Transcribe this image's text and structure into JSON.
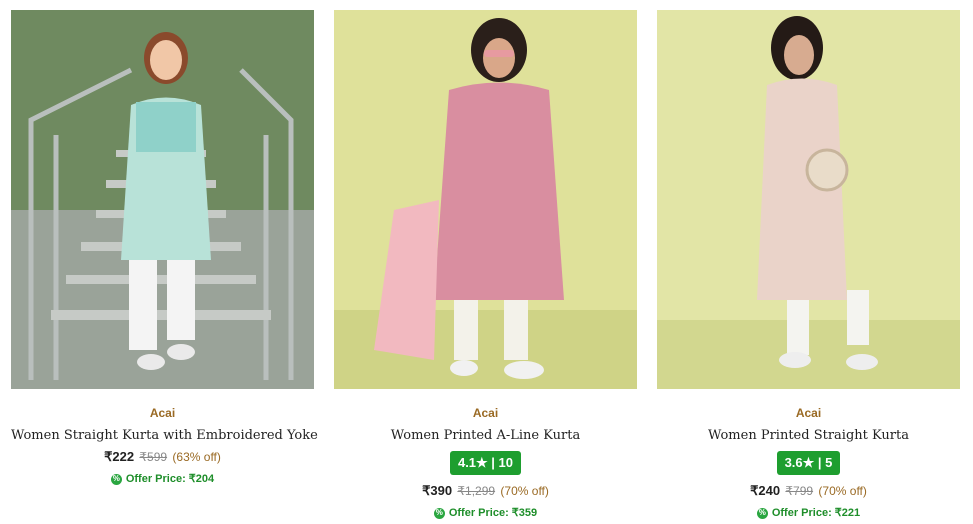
{
  "products": [
    {
      "brand": "Acai",
      "title": "Women Straight Kurta with Embroidered Yoke",
      "price": "₹222",
      "mrp": "₹599",
      "discount": "(63% off)",
      "offer": "Offer Price: ₹204",
      "image_desc_icon": "product-photo"
    },
    {
      "brand": "Acai",
      "title": "Women Printed A-Line Kurta",
      "rating": "4.1★ | 10",
      "price": "₹390",
      "mrp": "₹1,299",
      "discount": "(70% off)",
      "offer": "Offer Price: ₹359"
    },
    {
      "brand": "Acai",
      "title": "Women Printed Straight Kurta",
      "rating": "3.6★ | 5",
      "price": "₹240",
      "mrp": "₹799",
      "discount": "(70% off)",
      "offer": "Offer Price: ₹221"
    }
  ],
  "colors": {
    "brand": "#9a6a24",
    "rating_bg": "#1e9e2f",
    "offer": "#1e8e2a"
  }
}
